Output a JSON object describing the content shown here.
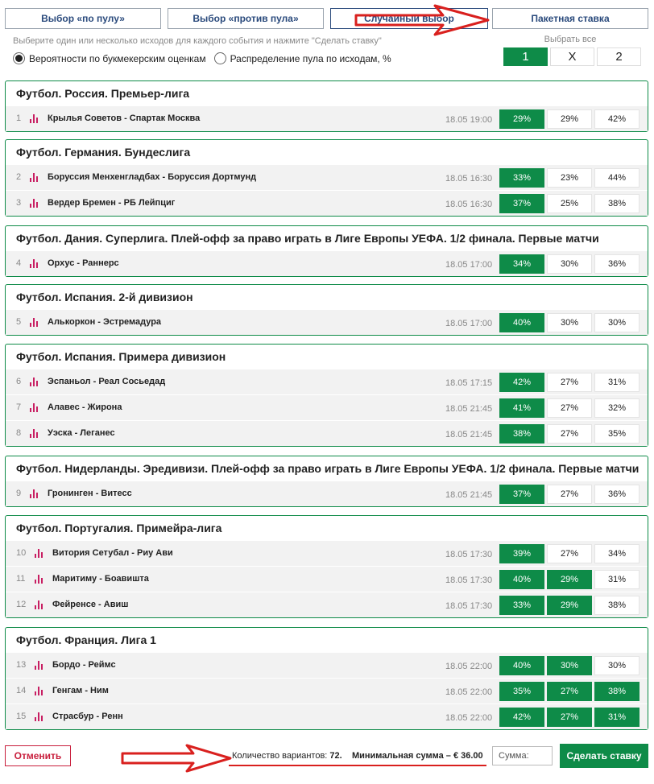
{
  "tabs": [
    {
      "label": "Выбор «по пулу»"
    },
    {
      "label": "Выбор «против пула»"
    },
    {
      "label": "Случайный выбор"
    },
    {
      "label": "Пакетная ставка"
    }
  ],
  "hint": "Выберите один или несколько исходов для каждого события и нажмите \"Сделать ставку\"",
  "radios": [
    {
      "label": "Вероятности по букмекерским оценкам",
      "checked": true
    },
    {
      "label": "Распределение пула по исходам, %",
      "checked": false
    }
  ],
  "select_all": {
    "label": "Выбрать все",
    "options": [
      "1",
      "X",
      "2"
    ],
    "selected": "1"
  },
  "sections": [
    {
      "title": "Футбол. Россия. Премьер-лига",
      "events": [
        {
          "num": "1",
          "match": "Крылья Советов - Спартак Москва",
          "time": "18.05 19:00",
          "p1": "29%",
          "px": "29%",
          "p2": "42%",
          "sel": [
            true,
            false,
            false
          ]
        }
      ]
    },
    {
      "title": "Футбол. Германия. Бундеслига",
      "events": [
        {
          "num": "2",
          "match": "Боруссия Менхенгладбах - Боруссия Дортмунд",
          "time": "18.05 16:30",
          "p1": "33%",
          "px": "23%",
          "p2": "44%",
          "sel": [
            true,
            false,
            false
          ]
        },
        {
          "num": "3",
          "match": "Вердер Бремен - РБ Лейпциг",
          "time": "18.05 16:30",
          "p1": "37%",
          "px": "25%",
          "p2": "38%",
          "sel": [
            true,
            false,
            false
          ]
        }
      ]
    },
    {
      "title": "Футбол. Дания. Суперлига. Плей-офф за право играть в Лиге Европы УЕФА. 1/2 финала. Первые матчи",
      "events": [
        {
          "num": "4",
          "match": "Орхус - Раннерс",
          "time": "18.05 17:00",
          "p1": "34%",
          "px": "30%",
          "p2": "36%",
          "sel": [
            true,
            false,
            false
          ]
        }
      ]
    },
    {
      "title": "Футбол. Испания. 2-й дивизион",
      "events": [
        {
          "num": "5",
          "match": "Алькоркон - Эстремадура",
          "time": "18.05 17:00",
          "p1": "40%",
          "px": "30%",
          "p2": "30%",
          "sel": [
            true,
            false,
            false
          ]
        }
      ]
    },
    {
      "title": "Футбол. Испания. Примера дивизион",
      "events": [
        {
          "num": "6",
          "match": "Эспаньол - Реал Сосьедад",
          "time": "18.05 17:15",
          "p1": "42%",
          "px": "27%",
          "p2": "31%",
          "sel": [
            true,
            false,
            false
          ]
        },
        {
          "num": "7",
          "match": "Алавес - Жирона",
          "time": "18.05 21:45",
          "p1": "41%",
          "px": "27%",
          "p2": "32%",
          "sel": [
            true,
            false,
            false
          ]
        },
        {
          "num": "8",
          "match": "Уэска - Леганес",
          "time": "18.05 21:45",
          "p1": "38%",
          "px": "27%",
          "p2": "35%",
          "sel": [
            true,
            false,
            false
          ]
        }
      ]
    },
    {
      "title": "Футбол. Нидерланды. Эредивизи. Плей-офф за право играть в Лиге Европы УЕФА. 1/2 финала. Первые матчи",
      "events": [
        {
          "num": "9",
          "match": "Гронинген - Витесс",
          "time": "18.05 21:45",
          "p1": "37%",
          "px": "27%",
          "p2": "36%",
          "sel": [
            true,
            false,
            false
          ]
        }
      ]
    },
    {
      "title": "Футбол. Португалия. Примейра-лига",
      "events": [
        {
          "num": "10",
          "match": "Витория Сетубал - Риу Ави",
          "time": "18.05 17:30",
          "p1": "39%",
          "px": "27%",
          "p2": "34%",
          "sel": [
            true,
            false,
            false
          ]
        },
        {
          "num": "11",
          "match": "Маритиму - Боавишта",
          "time": "18.05 17:30",
          "p1": "40%",
          "px": "29%",
          "p2": "31%",
          "sel": [
            true,
            true,
            false
          ]
        },
        {
          "num": "12",
          "match": "Фейренсе - Авиш",
          "time": "18.05 17:30",
          "p1": "33%",
          "px": "29%",
          "p2": "38%",
          "sel": [
            true,
            true,
            false
          ]
        }
      ]
    },
    {
      "title": "Футбол. Франция. Лига 1",
      "events": [
        {
          "num": "13",
          "match": "Бордо - Реймс",
          "time": "18.05 22:00",
          "p1": "40%",
          "px": "30%",
          "p2": "30%",
          "sel": [
            true,
            true,
            false
          ]
        },
        {
          "num": "14",
          "match": "Генгам - Ним",
          "time": "18.05 22:00",
          "p1": "35%",
          "px": "27%",
          "p2": "38%",
          "sel": [
            true,
            true,
            true
          ]
        },
        {
          "num": "15",
          "match": "Страсбур - Ренн",
          "time": "18.05 22:00",
          "p1": "42%",
          "px": "27%",
          "p2": "31%",
          "sel": [
            true,
            true,
            true
          ]
        }
      ]
    }
  ],
  "footer": {
    "cancel_label": "Отменить",
    "variants_label": "Количество вариантов:",
    "variants_value": "72.",
    "min_sum_label": "Минимальная сумма – € 36.00",
    "sum_placeholder": "Сумма:",
    "bet_label": "Сделать ставку"
  },
  "colors": {
    "accent": "#0e8b48",
    "link": "#2a4a7c",
    "danger": "#c81e3c",
    "annotation": "#d9201e"
  }
}
